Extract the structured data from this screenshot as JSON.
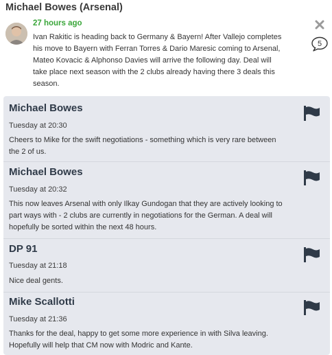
{
  "header": {
    "title": "Michael Bowes (Arsenal)"
  },
  "post": {
    "time": "27 hours ago",
    "body": "Ivan Rakitic is heading back to Germany & Bayern! After Vallejo completes his move to Bayern with Ferran Torres & Dario Maresic coming to Arsenal, Mateo Kovacic & Alphonso Davies will arrive the following day. Deal will take place next season with the 2 clubs already having there 3 deals this season.",
    "comment_count": "5"
  },
  "comments": [
    {
      "author": "Michael Bowes",
      "time": "Tuesday at 20:30",
      "text": "Cheers to Mike for the swift negotiations - something which is very rare between the 2 of us."
    },
    {
      "author": "Michael Bowes",
      "time": "Tuesday at 20:32",
      "text": "This now leaves Arsenal with only Ilkay Gundogan that they are actively looking to part ways with - 2 clubs are currently in negotiations for the German. A deal will hopefully be sorted within the next 48 hours."
    },
    {
      "author": "DP 91",
      "time": "Tuesday at 21:18",
      "text": "Nice deal gents."
    },
    {
      "author": "Mike Scallotti",
      "time": "Tuesday at 21:36",
      "text": "Thanks for the deal, happy to get some more experience in with Silva leaving. Hopefully will help that CM now with Modric and Kante."
    }
  ],
  "colors": {
    "time_green": "#3aa63a",
    "panel_bg": "#e6e8ee",
    "flag": "#2f3a48"
  },
  "icons": {
    "close": "close-icon",
    "comment": "comment-bubble-icon",
    "flag": "flag-icon"
  }
}
